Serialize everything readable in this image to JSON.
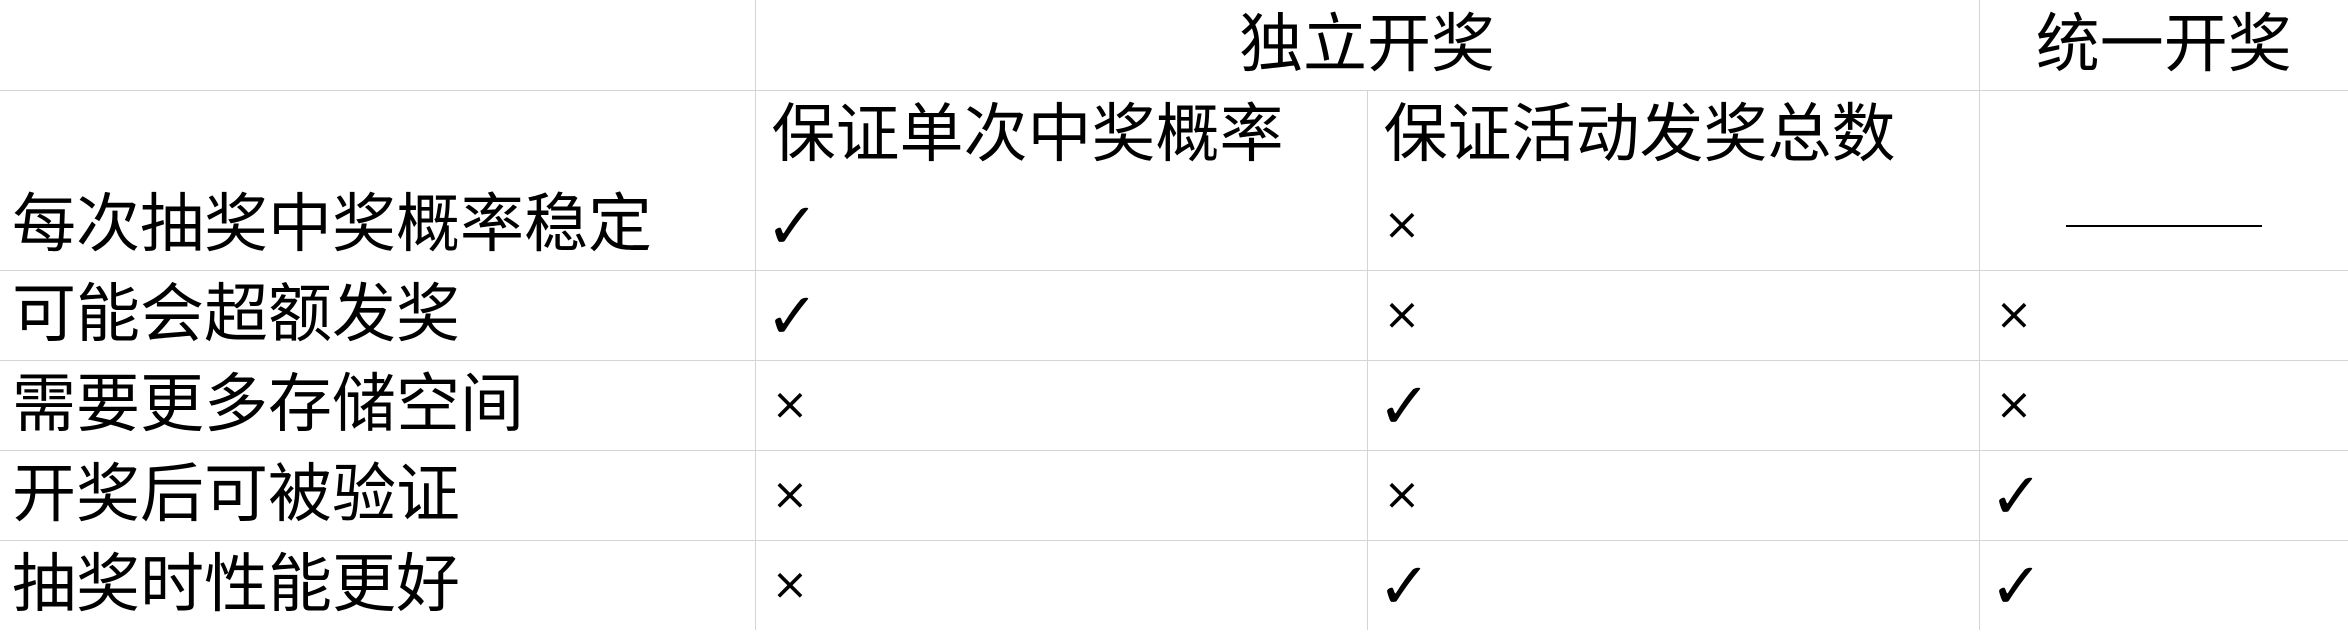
{
  "header": {
    "groups": [
      {
        "label": ""
      },
      {
        "label": "独立开奖"
      },
      {
        "label": "统一开奖"
      }
    ],
    "subheaders": [
      "",
      "保证单次中奖概率",
      "保证活动发奖总数",
      ""
    ]
  },
  "rows": [
    {
      "label": "每次抽奖中奖概率稳定",
      "cells": [
        {
          "mark": "check",
          "glyph": "✓"
        },
        {
          "mark": "cross",
          "glyph": "×"
        },
        {
          "mark": "dash",
          "glyph": ""
        }
      ]
    },
    {
      "label": "可能会超额发奖",
      "cells": [
        {
          "mark": "check",
          "glyph": "✓"
        },
        {
          "mark": "cross",
          "glyph": "×"
        },
        {
          "mark": "cross",
          "glyph": "×"
        }
      ]
    },
    {
      "label": "需要更多存储空间",
      "cells": [
        {
          "mark": "cross",
          "glyph": "×"
        },
        {
          "mark": "check",
          "glyph": "✓"
        },
        {
          "mark": "cross",
          "glyph": "×"
        }
      ]
    },
    {
      "label": "开奖后可被验证",
      "cells": [
        {
          "mark": "cross",
          "glyph": "×"
        },
        {
          "mark": "cross",
          "glyph": "×"
        },
        {
          "mark": "check",
          "glyph": "✓"
        }
      ]
    },
    {
      "label": "抽奖时性能更好",
      "cells": [
        {
          "mark": "cross",
          "glyph": "×"
        },
        {
          "mark": "check",
          "glyph": "✓"
        },
        {
          "mark": "check",
          "glyph": "✓"
        }
      ]
    }
  ]
}
